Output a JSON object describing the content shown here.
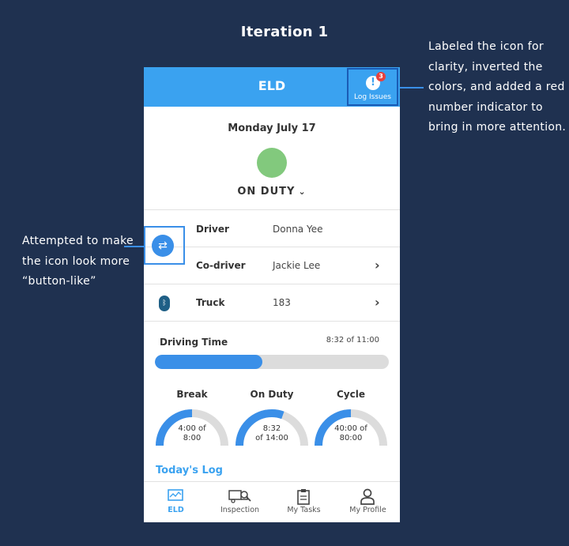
{
  "slide": {
    "title": "Iteration 1",
    "annotation_right": "Labeled the icon for clarity, inverted the colors, and added a red number indicator to bring in more attention.",
    "annotation_left": "Attempted to make the icon look more “button-like”"
  },
  "app": {
    "title": "ELD",
    "log_issues": {
      "label": "Log Issues",
      "count": "3",
      "icon": "exclamation-icon"
    },
    "date": "Monday July 17",
    "status": {
      "label": "ON DUTY",
      "color": "#82c97d"
    },
    "rows": [
      {
        "label": "Driver",
        "value": "Donna Yee",
        "icon": "swap-driver-icon"
      },
      {
        "label": "Co-driver",
        "value": "Jackie Lee",
        "chevron": "›"
      },
      {
        "label": "Truck",
        "value": "183",
        "chevron": "›",
        "icon": "bluetooth-icon"
      }
    ],
    "driving_time": {
      "label": "Driving Time",
      "value": "8:32 of 11:00",
      "progress": 0.46
    },
    "gauges": [
      {
        "label": "Break",
        "value_line1": "4:00 of",
        "value_line2": "8:00",
        "fraction": 0.5
      },
      {
        "label": "On Duty",
        "value_line1": "8:32",
        "value_line2": "of 14:00",
        "fraction": 0.61
      },
      {
        "label": "Cycle",
        "value_line1": "40:00 of",
        "value_line2": "80:00",
        "fraction": 0.5
      }
    ],
    "todays_log": "Today's Log",
    "nav": [
      {
        "label": "ELD",
        "icon": "eld-chart-icon",
        "active": true
      },
      {
        "label": "Inspection",
        "icon": "truck-inspect-icon",
        "active": false
      },
      {
        "label": "My Tasks",
        "icon": "clipboard-icon",
        "active": false
      },
      {
        "label": "My Profile",
        "icon": "person-icon",
        "active": false
      }
    ]
  },
  "colors": {
    "background": "#1f3150",
    "header": "#3aa2f0",
    "accent": "#3a8fe8",
    "badge": "#e8413c",
    "track": "#dcdcdc"
  }
}
